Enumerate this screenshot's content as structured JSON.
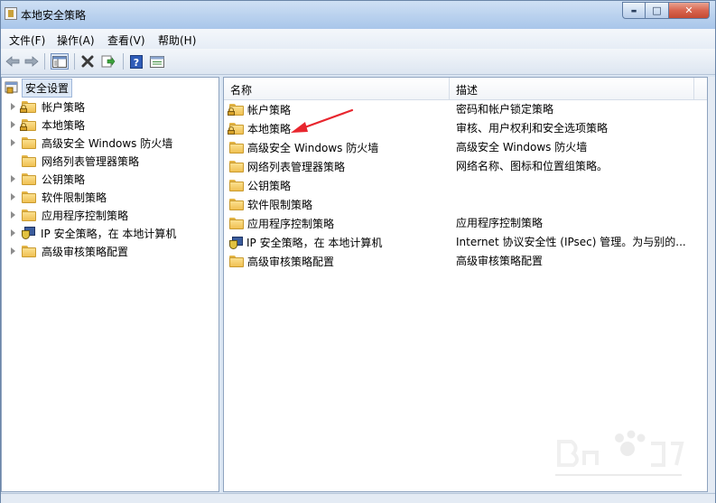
{
  "window": {
    "title": "本地安全策略"
  },
  "title_controls": {
    "minimize": "▬",
    "maximize": "□",
    "close": "✕"
  },
  "menu": [
    {
      "label": "文件(F)"
    },
    {
      "label": "操作(A)"
    },
    {
      "label": "查看(V)"
    },
    {
      "label": "帮助(H)"
    }
  ],
  "toolbar": {
    "buttons": [
      {
        "name": "back-arrow-icon"
      },
      {
        "name": "forward-arrow-icon"
      },
      {
        "name": "show-hide-tree-icon"
      },
      {
        "name": "delete-icon"
      },
      {
        "name": "export-list-icon"
      },
      {
        "name": "help-icon"
      },
      {
        "name": "properties-icon"
      }
    ]
  },
  "tree": {
    "root": "安全设置",
    "items": [
      {
        "label": "帐户策略",
        "icon": "locked-folder-icon",
        "expandable": true
      },
      {
        "label": "本地策略",
        "icon": "locked-folder-icon",
        "expandable": true
      },
      {
        "label": "高级安全 Windows 防火墙",
        "icon": "folder-icon",
        "expandable": true
      },
      {
        "label": "网络列表管理器策略",
        "icon": "folder-icon",
        "expandable": false
      },
      {
        "label": "公钥策略",
        "icon": "folder-icon",
        "expandable": true
      },
      {
        "label": "软件限制策略",
        "icon": "folder-icon",
        "expandable": true
      },
      {
        "label": "应用程序控制策略",
        "icon": "folder-icon",
        "expandable": true
      },
      {
        "label": "IP 安全策略，在 本地计算机",
        "icon": "ipsec-icon",
        "expandable": true
      },
      {
        "label": "高级审核策略配置",
        "icon": "folder-icon",
        "expandable": true
      }
    ]
  },
  "list": {
    "columns": [
      "名称",
      "描述"
    ],
    "rows": [
      {
        "name": "帐户策略",
        "desc": "密码和帐户锁定策略",
        "icon": "locked-folder-icon"
      },
      {
        "name": "本地策略",
        "desc": "审核、用户权利和安全选项策略",
        "icon": "locked-folder-icon"
      },
      {
        "name": "高级安全 Windows 防火墙",
        "desc": "高级安全 Windows 防火墙",
        "icon": "folder-icon"
      },
      {
        "name": "网络列表管理器策略",
        "desc": "网络名称、图标和位置组策略。",
        "icon": "folder-icon"
      },
      {
        "name": "公钥策略",
        "desc": "",
        "icon": "folder-icon"
      },
      {
        "name": "软件限制策略",
        "desc": "",
        "icon": "folder-icon"
      },
      {
        "name": "应用程序控制策略",
        "desc": "应用程序控制策略",
        "icon": "folder-icon"
      },
      {
        "name": "IP 安全策略，在 本地计算机",
        "desc": "Internet 协议安全性 (IPsec) 管理。为与别的...",
        "icon": "ipsec-icon"
      },
      {
        "name": "高级审核策略配置",
        "desc": "高级审核策略配置",
        "icon": "folder-icon"
      }
    ]
  },
  "colors": {
    "arrow": "#e8262e",
    "folder": "#f0c052",
    "frame": "#dbe6f3"
  }
}
